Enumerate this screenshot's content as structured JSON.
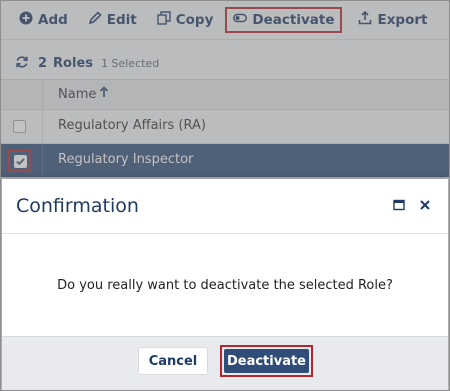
{
  "toolbar": {
    "add_label": "Add",
    "edit_label": "Edit",
    "copy_label": "Copy",
    "deactivate_label": "Deactivate",
    "export_label": "Export"
  },
  "summary": {
    "count": "2",
    "entity": "Roles",
    "selected_text": "1 Selected"
  },
  "grid": {
    "column_name": "Name",
    "rows": [
      {
        "name": "Regulatory Affairs (RA)",
        "checked": false
      },
      {
        "name": "Regulatory Inspector",
        "checked": true
      }
    ]
  },
  "dialog": {
    "title": "Confirmation",
    "message": "Do you really want to deactivate the selected Role?",
    "cancel_label": "Cancel",
    "confirm_label": "Deactivate"
  },
  "colors": {
    "primary": "#2f4d78",
    "highlight_border": "#b3262e",
    "text_dark": "#1e3a66"
  }
}
